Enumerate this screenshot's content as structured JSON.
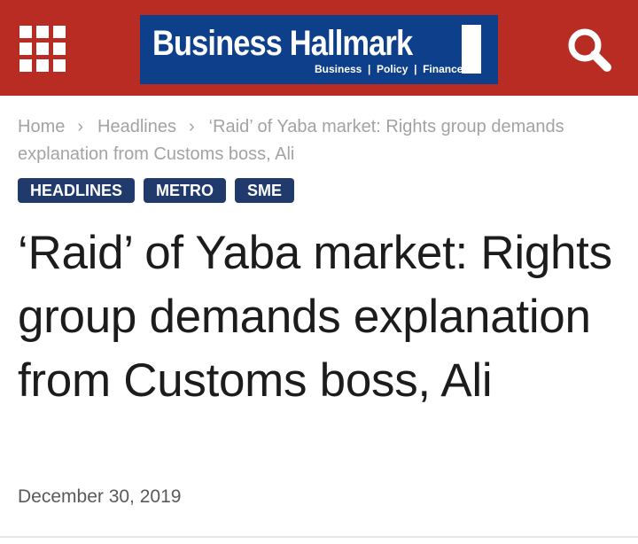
{
  "header": {
    "logo": {
      "name": "Business Hallmark",
      "tagline": "Business  |  Policy  |  Finance"
    },
    "icons": {
      "menu": "grid-menu-icon",
      "search": "search-icon"
    },
    "colors": {
      "header_bg": "#b82c24",
      "logo_bg": "#0e3f8a",
      "category_bg": "#1f3a6b"
    }
  },
  "breadcrumb": {
    "home": "Home",
    "section": "Headlines",
    "current": "‘Raid’ of Yaba market: Rights group demands explanation from Customs boss, Ali",
    "separator": "›"
  },
  "categories": [
    "HEADLINES",
    "METRO",
    "SME"
  ],
  "article": {
    "title": "‘Raid’ of Yaba market: Rights group demands explanation from Customs boss, Ali",
    "date": "December 30, 2019"
  }
}
